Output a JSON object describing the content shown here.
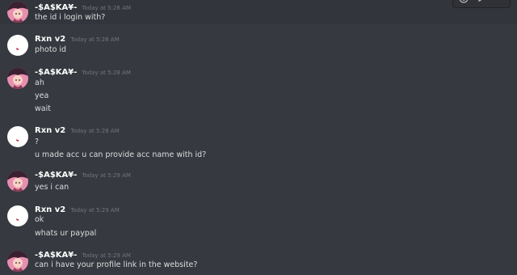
{
  "colors": {
    "background": "#36393f",
    "hover_row": "#32353b",
    "username": "#ffffff",
    "timestamp": "#72767d",
    "message_text": "#dcddde"
  },
  "toolbar": {
    "icons": [
      "emoji-icon",
      "edit-icon",
      "more-icon"
    ]
  },
  "messages": [
    {
      "username": "-$A$KA¥-",
      "timestamp": "Today at 5:28 AM",
      "avatar": "anime-avatar",
      "lines": [
        "the id i login with?"
      ]
    },
    {
      "username": "Rxn v2",
      "timestamp": "Today at 5:28 AM",
      "avatar": "white-avatar",
      "lines": [
        "photo id"
      ]
    },
    {
      "username": "-$A$KA¥-",
      "timestamp": "Today at 5:28 AM",
      "avatar": "anime-avatar",
      "lines": [
        "ah",
        "yea",
        "wait"
      ]
    },
    {
      "username": "Rxn v2",
      "timestamp": "Today at 5:28 AM",
      "avatar": "white-avatar",
      "lines": [
        "?",
        "u made acc u can provide acc name with id?"
      ]
    },
    {
      "username": "-$A$KA¥-",
      "timestamp": "Today at 5:29 AM",
      "avatar": "anime-avatar",
      "lines": [
        "yes i can"
      ]
    },
    {
      "username": "Rxn v2",
      "timestamp": "Today at 5:29 AM",
      "avatar": "white-avatar",
      "lines": [
        "ok",
        "whats ur paypal"
      ]
    },
    {
      "username": "-$A$KA¥-",
      "timestamp": "Today at 5:29 AM",
      "avatar": "anime-avatar",
      "lines": [
        "can i have your profile link in the website?"
      ]
    }
  ]
}
